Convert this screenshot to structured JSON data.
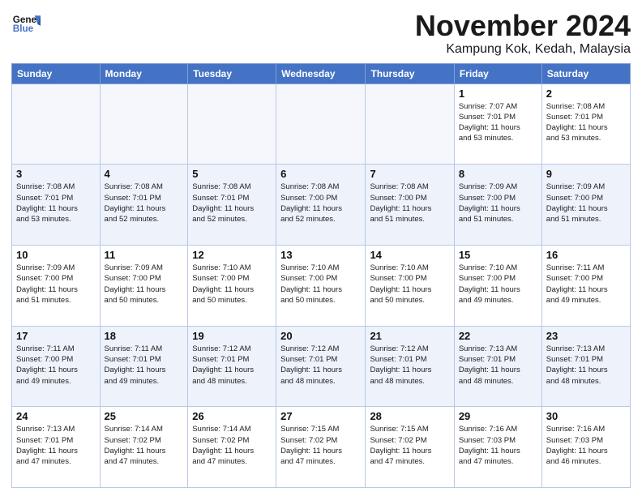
{
  "header": {
    "logo_line1": "General",
    "logo_line2": "Blue",
    "month": "November 2024",
    "location": "Kampung Kok, Kedah, Malaysia"
  },
  "weekdays": [
    "Sunday",
    "Monday",
    "Tuesday",
    "Wednesday",
    "Thursday",
    "Friday",
    "Saturday"
  ],
  "weeks": [
    [
      {
        "day": "",
        "info": ""
      },
      {
        "day": "",
        "info": ""
      },
      {
        "day": "",
        "info": ""
      },
      {
        "day": "",
        "info": ""
      },
      {
        "day": "",
        "info": ""
      },
      {
        "day": "1",
        "info": "Sunrise: 7:07 AM\nSunset: 7:01 PM\nDaylight: 11 hours\nand 53 minutes."
      },
      {
        "day": "2",
        "info": "Sunrise: 7:08 AM\nSunset: 7:01 PM\nDaylight: 11 hours\nand 53 minutes."
      }
    ],
    [
      {
        "day": "3",
        "info": "Sunrise: 7:08 AM\nSunset: 7:01 PM\nDaylight: 11 hours\nand 53 minutes."
      },
      {
        "day": "4",
        "info": "Sunrise: 7:08 AM\nSunset: 7:01 PM\nDaylight: 11 hours\nand 52 minutes."
      },
      {
        "day": "5",
        "info": "Sunrise: 7:08 AM\nSunset: 7:01 PM\nDaylight: 11 hours\nand 52 minutes."
      },
      {
        "day": "6",
        "info": "Sunrise: 7:08 AM\nSunset: 7:00 PM\nDaylight: 11 hours\nand 52 minutes."
      },
      {
        "day": "7",
        "info": "Sunrise: 7:08 AM\nSunset: 7:00 PM\nDaylight: 11 hours\nand 51 minutes."
      },
      {
        "day": "8",
        "info": "Sunrise: 7:09 AM\nSunset: 7:00 PM\nDaylight: 11 hours\nand 51 minutes."
      },
      {
        "day": "9",
        "info": "Sunrise: 7:09 AM\nSunset: 7:00 PM\nDaylight: 11 hours\nand 51 minutes."
      }
    ],
    [
      {
        "day": "10",
        "info": "Sunrise: 7:09 AM\nSunset: 7:00 PM\nDaylight: 11 hours\nand 51 minutes."
      },
      {
        "day": "11",
        "info": "Sunrise: 7:09 AM\nSunset: 7:00 PM\nDaylight: 11 hours\nand 50 minutes."
      },
      {
        "day": "12",
        "info": "Sunrise: 7:10 AM\nSunset: 7:00 PM\nDaylight: 11 hours\nand 50 minutes."
      },
      {
        "day": "13",
        "info": "Sunrise: 7:10 AM\nSunset: 7:00 PM\nDaylight: 11 hours\nand 50 minutes."
      },
      {
        "day": "14",
        "info": "Sunrise: 7:10 AM\nSunset: 7:00 PM\nDaylight: 11 hours\nand 50 minutes."
      },
      {
        "day": "15",
        "info": "Sunrise: 7:10 AM\nSunset: 7:00 PM\nDaylight: 11 hours\nand 49 minutes."
      },
      {
        "day": "16",
        "info": "Sunrise: 7:11 AM\nSunset: 7:00 PM\nDaylight: 11 hours\nand 49 minutes."
      }
    ],
    [
      {
        "day": "17",
        "info": "Sunrise: 7:11 AM\nSunset: 7:00 PM\nDaylight: 11 hours\nand 49 minutes."
      },
      {
        "day": "18",
        "info": "Sunrise: 7:11 AM\nSunset: 7:01 PM\nDaylight: 11 hours\nand 49 minutes."
      },
      {
        "day": "19",
        "info": "Sunrise: 7:12 AM\nSunset: 7:01 PM\nDaylight: 11 hours\nand 48 minutes."
      },
      {
        "day": "20",
        "info": "Sunrise: 7:12 AM\nSunset: 7:01 PM\nDaylight: 11 hours\nand 48 minutes."
      },
      {
        "day": "21",
        "info": "Sunrise: 7:12 AM\nSunset: 7:01 PM\nDaylight: 11 hours\nand 48 minutes."
      },
      {
        "day": "22",
        "info": "Sunrise: 7:13 AM\nSunset: 7:01 PM\nDaylight: 11 hours\nand 48 minutes."
      },
      {
        "day": "23",
        "info": "Sunrise: 7:13 AM\nSunset: 7:01 PM\nDaylight: 11 hours\nand 48 minutes."
      }
    ],
    [
      {
        "day": "24",
        "info": "Sunrise: 7:13 AM\nSunset: 7:01 PM\nDaylight: 11 hours\nand 47 minutes."
      },
      {
        "day": "25",
        "info": "Sunrise: 7:14 AM\nSunset: 7:02 PM\nDaylight: 11 hours\nand 47 minutes."
      },
      {
        "day": "26",
        "info": "Sunrise: 7:14 AM\nSunset: 7:02 PM\nDaylight: 11 hours\nand 47 minutes."
      },
      {
        "day": "27",
        "info": "Sunrise: 7:15 AM\nSunset: 7:02 PM\nDaylight: 11 hours\nand 47 minutes."
      },
      {
        "day": "28",
        "info": "Sunrise: 7:15 AM\nSunset: 7:02 PM\nDaylight: 11 hours\nand 47 minutes."
      },
      {
        "day": "29",
        "info": "Sunrise: 7:16 AM\nSunset: 7:03 PM\nDaylight: 11 hours\nand 47 minutes."
      },
      {
        "day": "30",
        "info": "Sunrise: 7:16 AM\nSunset: 7:03 PM\nDaylight: 11 hours\nand 46 minutes."
      }
    ]
  ]
}
